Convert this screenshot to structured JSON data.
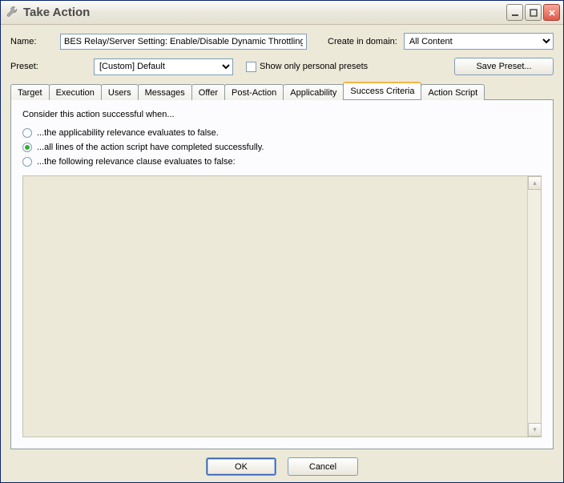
{
  "window": {
    "title": "Take Action"
  },
  "form": {
    "name_label": "Name:",
    "name_value": "BES Relay/Server Setting: Enable/Disable Dynamic Throttling",
    "domain_label": "Create in domain:",
    "domain_value": "All Content",
    "preset_label": "Preset:",
    "preset_value": "[Custom] Default",
    "show_personal_label": "Show only personal presets",
    "show_personal_checked": false,
    "save_preset_label": "Save Preset..."
  },
  "tabs": [
    {
      "label": "Target",
      "active": false
    },
    {
      "label": "Execution",
      "active": false
    },
    {
      "label": "Users",
      "active": false
    },
    {
      "label": "Messages",
      "active": false
    },
    {
      "label": "Offer",
      "active": false
    },
    {
      "label": "Post-Action",
      "active": false
    },
    {
      "label": "Applicability",
      "active": false
    },
    {
      "label": "Success Criteria",
      "active": true
    },
    {
      "label": "Action Script",
      "active": false
    }
  ],
  "success": {
    "heading": "Consider this action successful when...",
    "options": [
      {
        "label": "...the applicability relevance evaluates to false.",
        "checked": false
      },
      {
        "label": "...all lines of the action script have completed successfully.",
        "checked": true
      },
      {
        "label": "...the following relevance clause evaluates to false:",
        "checked": false
      }
    ],
    "relevance_text": ""
  },
  "footer": {
    "ok": "OK",
    "cancel": "Cancel"
  }
}
